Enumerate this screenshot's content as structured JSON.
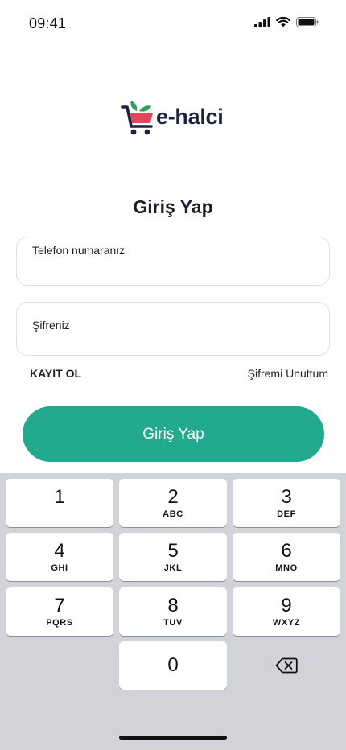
{
  "status_bar": {
    "time": "09:41"
  },
  "logo": {
    "text": "e-halci"
  },
  "login": {
    "title": "Giriş Yap",
    "phone_label": "Telefon numaranız",
    "password_label": "Şifreniz",
    "register_link": "KAYIT OL",
    "forgot_link": "Şifremi Unuttum",
    "submit_label": "Giriş Yap"
  },
  "colors": {
    "primary": "#23a98d",
    "logo_cart": "#1b2340",
    "logo_basket": "#e2475f",
    "logo_leaf": "#2f9e59",
    "keyboard_bg": "#d1d3d9"
  },
  "keypad": {
    "keys": [
      {
        "digit": "1",
        "letters": ""
      },
      {
        "digit": "2",
        "letters": "ABC"
      },
      {
        "digit": "3",
        "letters": "DEF"
      },
      {
        "digit": "4",
        "letters": "GHI"
      },
      {
        "digit": "5",
        "letters": "JKL"
      },
      {
        "digit": "6",
        "letters": "MNO"
      },
      {
        "digit": "7",
        "letters": "PQRS"
      },
      {
        "digit": "8",
        "letters": "TUV"
      },
      {
        "digit": "9",
        "letters": "WXYZ"
      },
      {
        "digit": "0",
        "letters": ""
      }
    ],
    "backspace_icon": "backspace-icon"
  }
}
